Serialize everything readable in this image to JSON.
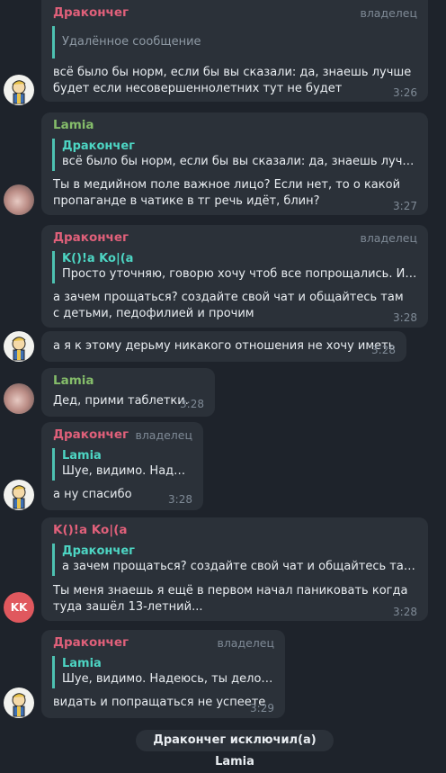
{
  "colors": {
    "background": "#1e232b",
    "bubble": "#2b3139",
    "name_dracon": "#e0607a",
    "name_lamia": "#85bd6a",
    "quote_accent": "#4dd5c3",
    "avatar_kk": "#e0585e"
  },
  "messages": [
    {
      "sender": "Дракончег",
      "role": "владелец",
      "quote_deleted": "Удалённое сообщение",
      "text": "всё было бы норм, если бы вы сказали: да, знаешь лучше будет если несовершеннолетних тут не будет",
      "time": "3:26",
      "avatar": "dracon-avatar"
    },
    {
      "sender": "Lamia",
      "quote_name": "Дракончег",
      "quote_text": "всё было бы норм, если бы вы сказали: да, знаешь лучше буд...",
      "text": "Ты в медийном поле важное лицо? Если нет, то о какой пропаганде в чатике в тг речь идёт, блин?",
      "time": "3:27",
      "avatar": "lamia-avatar"
    },
    {
      "sender": "Дракончег",
      "role": "владелец",
      "quote_name": "K()!a Ko|(a",
      "quote_text": "Просто уточняю, говорю хочу чтоб все попрощались. И нет ...",
      "text": "а зачем прощаться? создайте свой чат и общайтесь там с детьми, педофилией и прочим",
      "time": "3:28"
    },
    {
      "text": "а я к этому дерьму никакого отношения не хочу иметь",
      "time": "3:28",
      "avatar": "dracon-avatar"
    },
    {
      "sender": "Lamia",
      "text": "Дед, прими таблетки.",
      "time": "3:28",
      "avatar": "lamia-avatar"
    },
    {
      "sender": "Дракончег",
      "role": "владелец",
      "quote_name": "Lamia",
      "quote_text": "Шуе, видимо.  Надею...",
      "text": "а ну спасибо",
      "time": "3:28",
      "avatar": "dracon-avatar"
    },
    {
      "sender": "K()!a Ko|(a",
      "quote_name": "Дракончег",
      "quote_text": "а зачем прощаться? создайте свой чат и общайтесь там с дет...",
      "text": "Ты меня знаешь я ещё в первом начал паниковать когда туда зашёл 13-летний...",
      "time": "3:28",
      "avatar": "KK"
    },
    {
      "sender": "Дракончег",
      "role": "владелец",
      "quote_name": "Lamia",
      "quote_text": "Шуе, видимо.  Надеюсь, ты делов не...",
      "text": "видать и попращаться не успеете",
      "time": "3:29",
      "avatar": "dracon-avatar"
    }
  ],
  "service": "Дракончег исключил(а) Lamia"
}
